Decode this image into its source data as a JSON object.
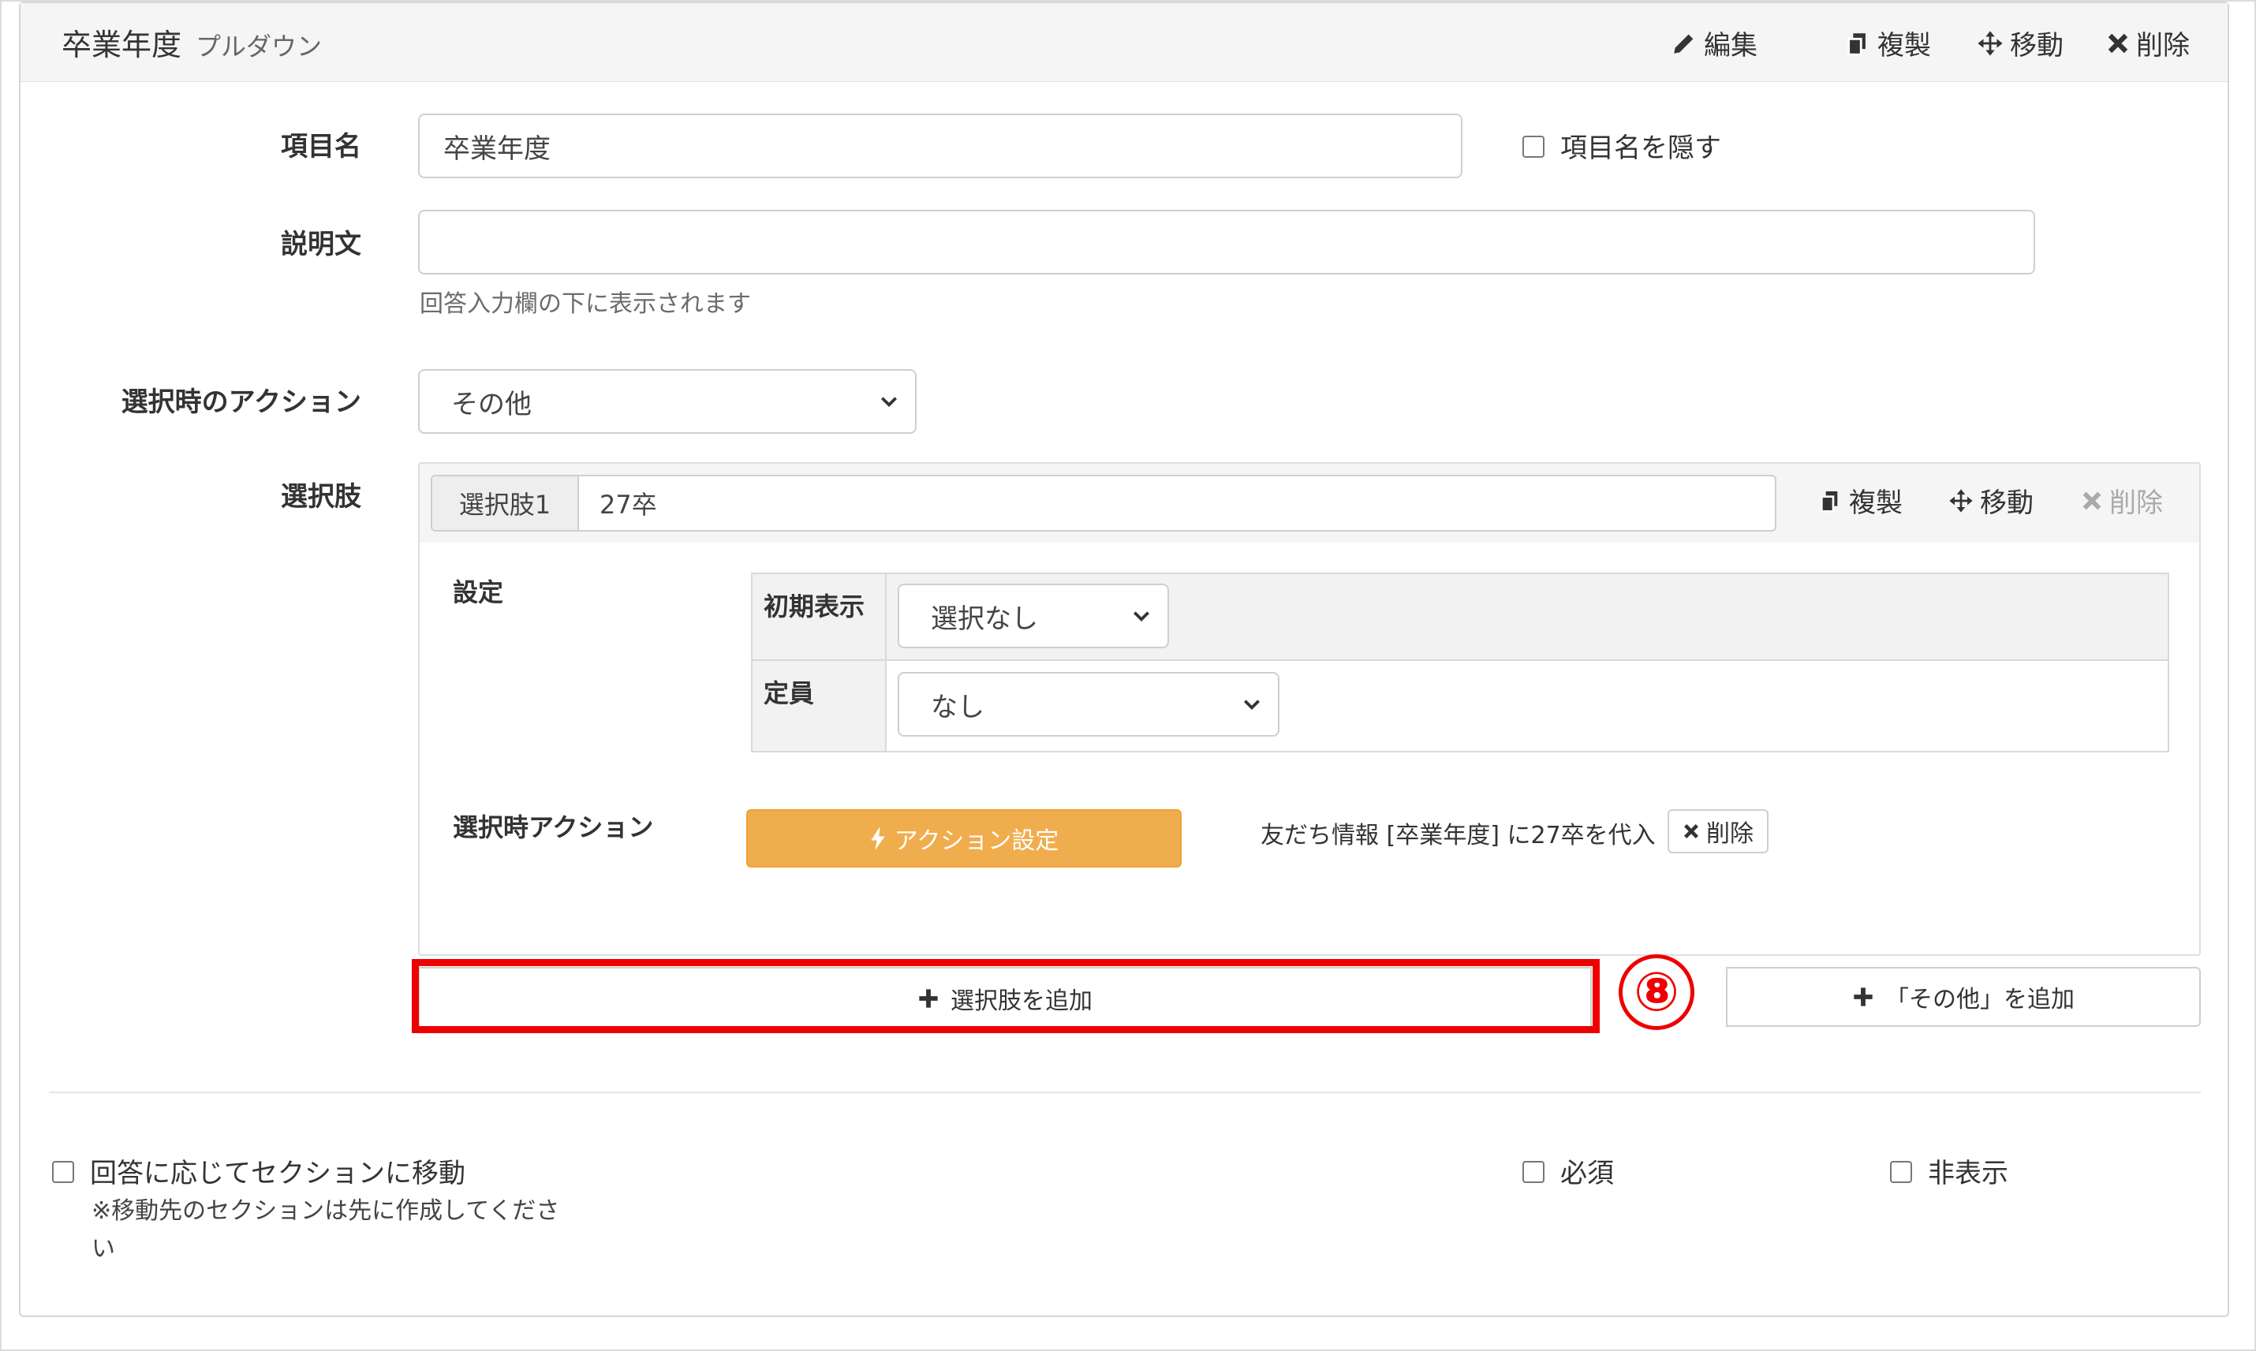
{
  "header": {
    "title": "卒業年度",
    "subtitle": "プルダウン",
    "actions": [
      {
        "icon": "pencil-icon",
        "label": "編集"
      },
      {
        "icon": "copy-icon",
        "label": "複製"
      },
      {
        "icon": "move-icon",
        "label": "移動"
      },
      {
        "icon": "close-icon",
        "label": "削除"
      }
    ]
  },
  "form": {
    "item_name_label": "項目名",
    "item_name_value": "卒業年度",
    "hide_item_name_label": "項目名を隠す",
    "description_label": "説明文",
    "description_value": "",
    "description_help": "回答入力欄の下に表示されます",
    "select_action_label": "選択時のアクション",
    "select_action_value": "その他",
    "options_label": "選択肢"
  },
  "option": {
    "addon_label": "選択肢1",
    "value": "27卒",
    "actions": [
      {
        "icon": "copy-icon",
        "label": "複製",
        "disabled": false
      },
      {
        "icon": "move-icon",
        "label": "移動",
        "disabled": false
      },
      {
        "icon": "close-icon",
        "label": "削除",
        "disabled": true
      }
    ],
    "settings_label": "設定",
    "initial_display_label": "初期表示",
    "initial_display_value": "選択なし",
    "capacity_label": "定員",
    "capacity_value": "なし",
    "action_label": "選択時アクション",
    "action_button_label": "アクション設定",
    "action_summary": "友だち情報 [卒業年度] に27卒を代入",
    "action_delete_label": "削除"
  },
  "add_option_label": "選択肢を追加",
  "add_other_label": "「その他」を追加",
  "annotation_number": "⑧",
  "footer": {
    "section_move_label": "回答に応じてセクションに移動",
    "section_move_note": "※移動先のセクションは先に作成してください",
    "required_label": "必須",
    "hidden_label": "非表示"
  },
  "colors": {
    "accent_orange": "#f0ad4e",
    "annotation_red": "#ee0000"
  }
}
